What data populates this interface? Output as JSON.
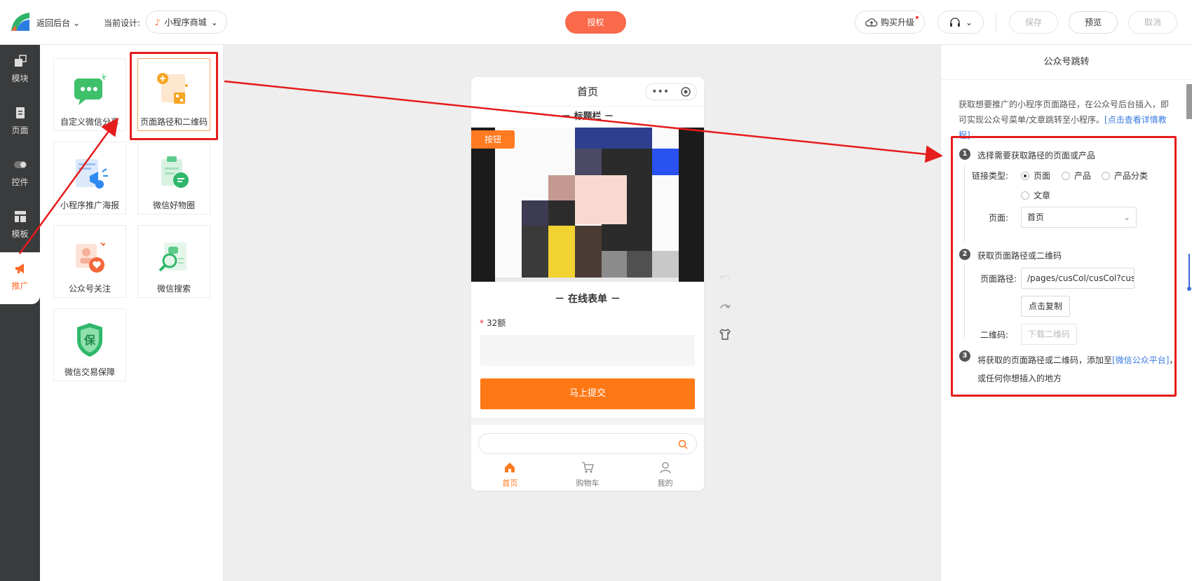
{
  "topbar": {
    "back_label": "返回后台",
    "current_design_label": "当前设计:",
    "current_design_value": "小程序商城",
    "authorize_label": "授权",
    "upgrade_label": "购买升级",
    "save_label": "保存",
    "preview_label": "预览",
    "cancel_label": "取消"
  },
  "sidebar": {
    "items": [
      {
        "label": "模块",
        "icon": "module-icon"
      },
      {
        "label": "页面",
        "icon": "page-icon"
      },
      {
        "label": "控件",
        "icon": "toggle-icon"
      },
      {
        "label": "模板",
        "icon": "template-icon"
      },
      {
        "label": "推广",
        "icon": "megaphone-icon"
      }
    ],
    "active": "推广"
  },
  "widgets": [
    {
      "label": "自定义微信分享"
    },
    {
      "label": "页面路径和二维码"
    },
    {
      "label": "小程序推广海报"
    },
    {
      "label": "微信好物圈"
    },
    {
      "label": "公众号关注"
    },
    {
      "label": "微信搜索"
    },
    {
      "label": "微信交易保障",
      "badge": "保"
    }
  ],
  "phone": {
    "page_title": "首页",
    "title_bar": "－ 标题栏 －",
    "hero_button": "按钮",
    "form_title": "－ 在线表单 －",
    "field_required_mark": "*",
    "field_label": "32额",
    "submit_label": "马上提交",
    "tabs": [
      {
        "label": "首页",
        "icon": "home-icon"
      },
      {
        "label": "购物车",
        "icon": "cart-icon"
      },
      {
        "label": "我的",
        "icon": "user-icon"
      }
    ]
  },
  "right_panel": {
    "title": "公众号跳转",
    "desc": "获取想要推广的小程序页面路径，在公众号后台插入，即可实现公众号菜单/文章跳转至小程序。",
    "desc_link": "[点击查看详情教程]",
    "step1": {
      "num": "1",
      "text": "选择需要获取路径的页面或产品",
      "link_type_label": "链接类型:",
      "options": [
        "页面",
        "产品",
        "产品分类",
        "文章"
      ],
      "selected_option": "页面",
      "page_label": "页面:",
      "page_value": "首页"
    },
    "step2": {
      "num": "2",
      "text": "获取页面路径或二维码",
      "path_label": "页面路径:",
      "path_value": "/pages/cusCol/cusCol?cusC...",
      "copy_label": "点击复制",
      "qr_label": "二维码:",
      "qr_button": "下载二维码"
    },
    "step3": {
      "num": "3",
      "text_before": "将获取的页面路径或二维码，添加至",
      "link": "[微信公众平台]",
      "text_after": "，",
      "text_line2": "或任何你想插入的地方"
    }
  },
  "colors": {
    "accent": "#ff7a20",
    "authorize": "#f9694a",
    "annotation_red": "#e51c1c",
    "sidebar_bg": "#3a3b3c",
    "link_blue": "#3a7be0"
  }
}
